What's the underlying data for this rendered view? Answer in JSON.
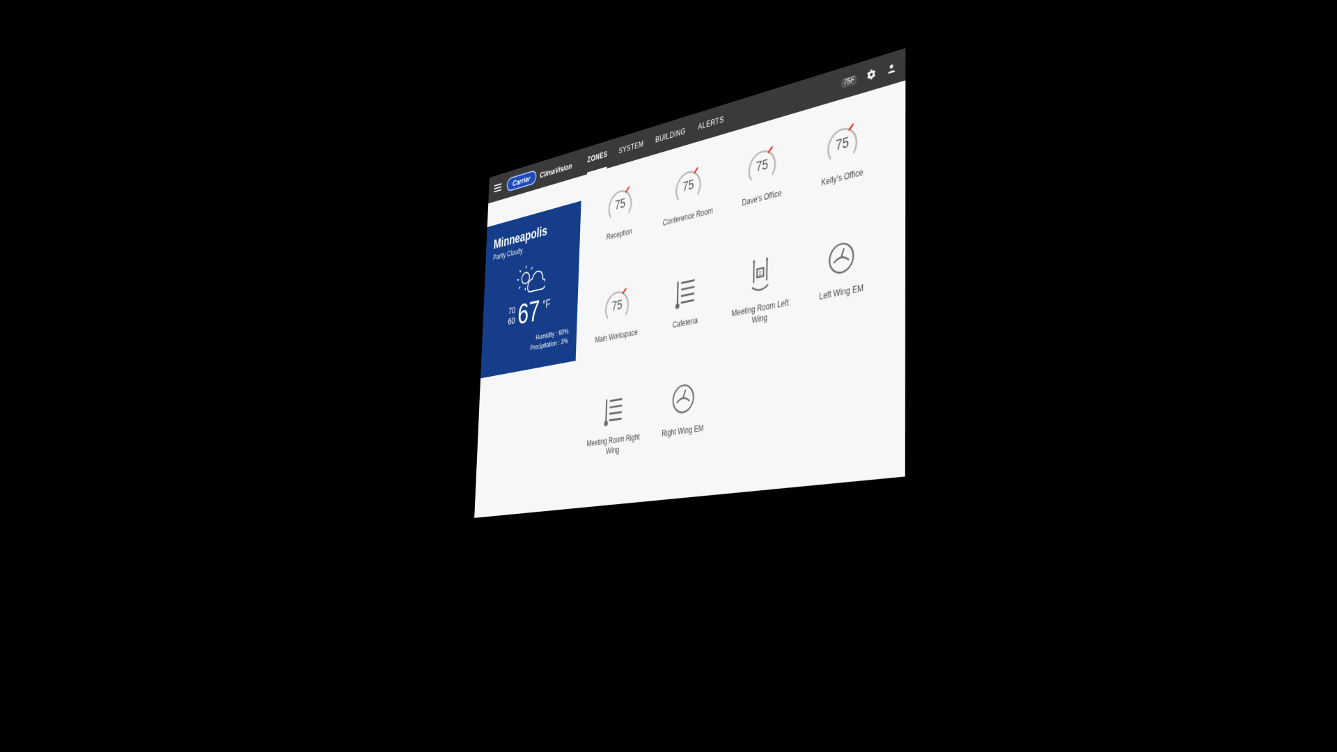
{
  "brand": {
    "pill": "Carrier",
    "name": "ClimaVision"
  },
  "tabs": [
    "ZONES",
    "SYSTEM",
    "BUILDING",
    "ALERTS"
  ],
  "active_tab": 0,
  "header_badge": "75F",
  "weather": {
    "city": "Minneapolis",
    "condition": "Partly Cloudy",
    "high": "70",
    "low": "60",
    "temp": "67",
    "unit": "°F",
    "humidity_label": "Humidity : 60%",
    "precip_label": "Precipitation : 3%"
  },
  "zones": [
    {
      "name": "Reception",
      "type": "gauge",
      "temp": "75"
    },
    {
      "name": "Conference Room",
      "type": "gauge",
      "temp": "75"
    },
    {
      "name": "Dave's Office",
      "type": "gauge",
      "temp": "75"
    },
    {
      "name": "Kelly's Office",
      "type": "gauge",
      "temp": "75"
    },
    {
      "name": "Main Workspace",
      "type": "gauge",
      "temp": "75"
    },
    {
      "name": "Cafeteria",
      "type": "vent"
    },
    {
      "name": "Meeting Room Left Wing",
      "type": "sensor"
    },
    {
      "name": "Left Wing EM",
      "type": "em"
    },
    {
      "name": "Meeting Room Right Wing",
      "type": "vent"
    },
    {
      "name": "Right Wing EM",
      "type": "em"
    }
  ]
}
